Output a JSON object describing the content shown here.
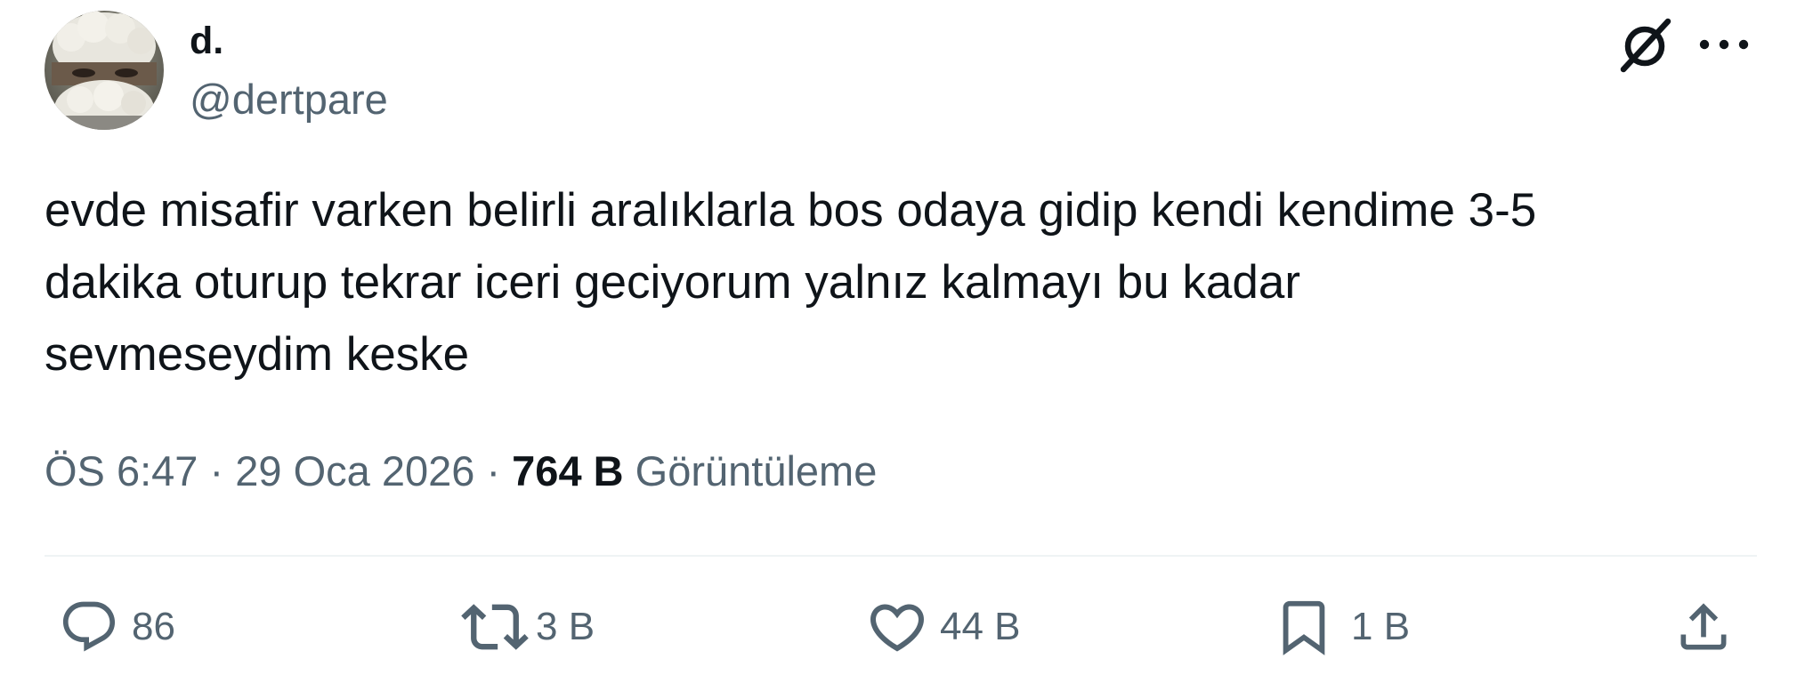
{
  "author": {
    "display_name": "d.",
    "handle": "@dertpare"
  },
  "icons": {
    "avatar": "avatar-photo",
    "grok": "grok-icon",
    "more": "more-options-icon",
    "reply": "reply-icon",
    "retweet": "retweet-icon",
    "like": "like-icon",
    "bookmark": "bookmark-icon",
    "share": "share-icon"
  },
  "tweet": {
    "text": "evde misafir varken belirli aralıklarla bos odaya gidip kendi kendime 3-5\ndakika oturup tekrar iceri geciyorum yalnız kalmayı bu kadar\nsevmeseydim keske"
  },
  "meta": {
    "time": "ÖS 6:47",
    "separator": " · ",
    "date": "29 Oca 2026",
    "views_count": "764 B",
    "views_label": "Görüntüleme"
  },
  "actions": {
    "replies": "86",
    "retweets": "3 B",
    "likes": "44 B",
    "bookmarks": "1 B"
  },
  "colors": {
    "text_primary": "#0f1419",
    "text_secondary": "#536471",
    "divider": "#eff3f4"
  }
}
